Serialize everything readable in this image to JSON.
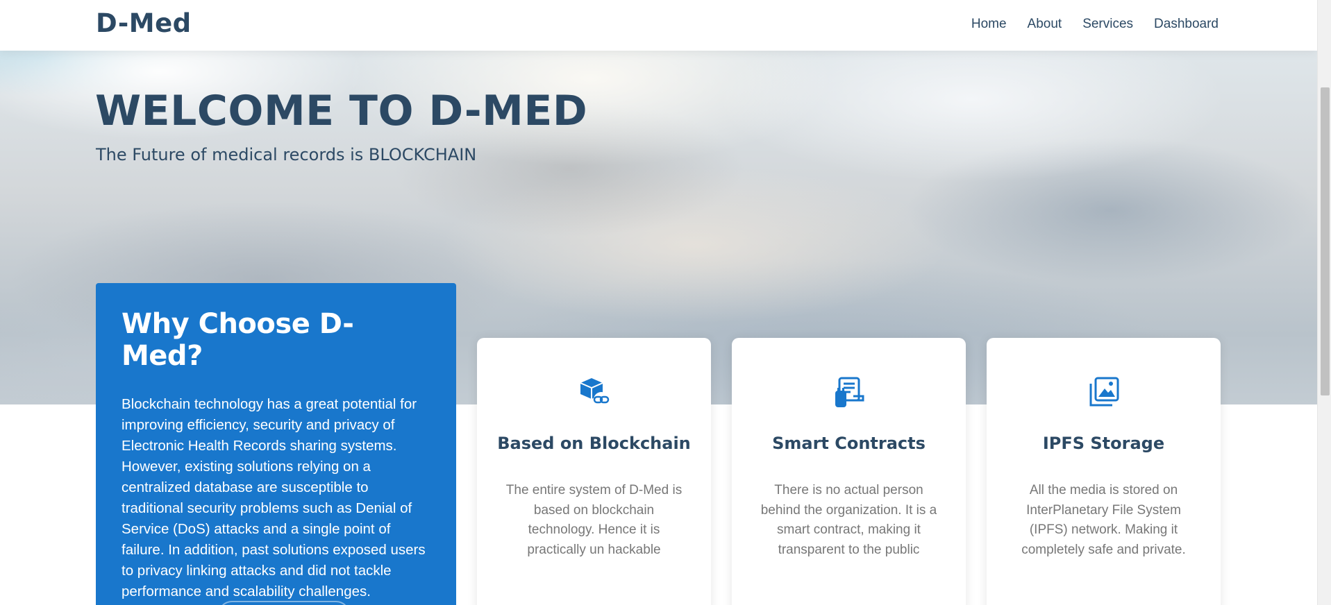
{
  "header": {
    "logo": "D-Med",
    "nav": [
      "Home",
      "About",
      "Services",
      "Dashboard"
    ]
  },
  "hero": {
    "title": "WELCOME TO D-MED",
    "subtitle": "The Future of medical records is BLOCKCHAIN"
  },
  "why": {
    "title": "Why Choose D-Med?",
    "text": "Blockchain technology has a great potential for improving efficiency, security and privacy of Electronic Health Records sharing systems. However, existing solutions relying on a centralized database are susceptible to traditional security problems such as Denial of Service (DoS) attacks and a single point of failure. In addition, past solutions exposed users to privacy linking attacks and did not tackle performance and scalability challenges."
  },
  "cards": [
    {
      "icon": "blockchain-cube-icon",
      "title": "Based on Blockchain",
      "text": "The entire system of D-Med is based on blockchain technology. Hence it is practically un hackable"
    },
    {
      "icon": "contract-document-icon",
      "title": "Smart Contracts",
      "text": "There is no actual person behind the organization. It is a smart contract, making it transparent to the public"
    },
    {
      "icon": "images-stack-icon",
      "title": "IPFS Storage",
      "text": "All the media is stored on InterPlanetary File System (IPFS) network. Making it completely safe and private."
    }
  ],
  "colors": {
    "primary": "#1977cc",
    "heading": "#2c4964",
    "body_text": "#777777"
  }
}
